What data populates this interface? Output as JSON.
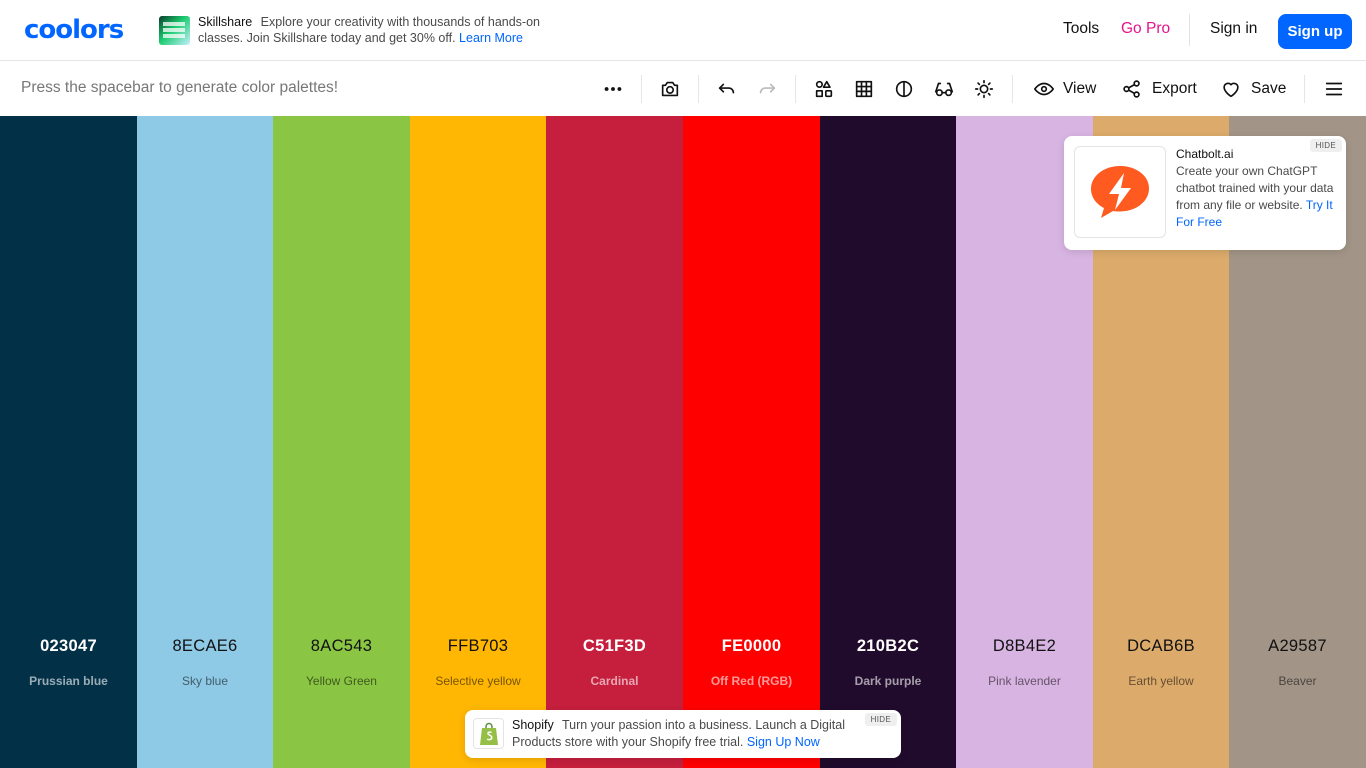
{
  "navbar": {
    "logo": "coolors",
    "ad": {
      "brand": "Skillshare",
      "text": "Explore your creativity with thousands of hands-on classes. Join Skillshare today and get 30% off.",
      "link": "Learn More"
    },
    "tools": "Tools",
    "go_pro": "Go Pro",
    "sign_in": "Sign in",
    "sign_up": "Sign up"
  },
  "toolbar": {
    "hint": "Press the spacebar to generate color palettes!",
    "icons": [
      "more-icon",
      "camera-icon",
      "undo-icon",
      "redo-icon",
      "shapes-icon",
      "grid-icon",
      "contrast-icon",
      "glasses-icon",
      "brightness-icon",
      "eye-icon",
      "share-icon",
      "heart-icon",
      "menu-icon"
    ],
    "view": "View",
    "export": "Export",
    "save": "Save"
  },
  "palette": [
    {
      "hex": "023047",
      "name": "Prussian blue",
      "color": "#023047",
      "tone": "dark"
    },
    {
      "hex": "8ECAE6",
      "name": "Sky blue",
      "color": "#8ECAE6",
      "tone": "light"
    },
    {
      "hex": "8AC543",
      "name": "Yellow Green",
      "color": "#8AC543",
      "tone": "light"
    },
    {
      "hex": "FFB703",
      "name": "Selective yellow",
      "color": "#FFB703",
      "tone": "light"
    },
    {
      "hex": "C51F3D",
      "name": "Cardinal",
      "color": "#C51F3D",
      "tone": "dark"
    },
    {
      "hex": "FE0000",
      "name": "Off Red (RGB)",
      "color": "#FE0000",
      "tone": "dark"
    },
    {
      "hex": "210B2C",
      "name": "Dark purple",
      "color": "#210B2C",
      "tone": "dark"
    },
    {
      "hex": "D8B4E2",
      "name": "Pink lavender",
      "color": "#D8B4E2",
      "tone": "light"
    },
    {
      "hex": "DCAB6B",
      "name": "Earth yellow",
      "color": "#DCAB6B",
      "tone": "light"
    },
    {
      "hex": "A29587",
      "name": "Beaver",
      "color": "#A29587",
      "tone": "light"
    }
  ],
  "ads": {
    "chatbolt": {
      "brand": "Chatbolt.ai",
      "text": "Create your own ChatGPT chatbot trained with your data from any file or website.",
      "link": "Try It For Free",
      "hide": "HIDE"
    },
    "shopify": {
      "brand": "Shopify",
      "text": "Turn your passion into a business. Launch a Digital Products store with your Shopify free trial.",
      "link": "Sign Up Now",
      "hide": "HIDE"
    }
  },
  "colors": {
    "accent": "#0066ff",
    "go_pro": "#e6138a",
    "chatbolt": "#ff5a1f",
    "shopify": "#95bf47"
  }
}
